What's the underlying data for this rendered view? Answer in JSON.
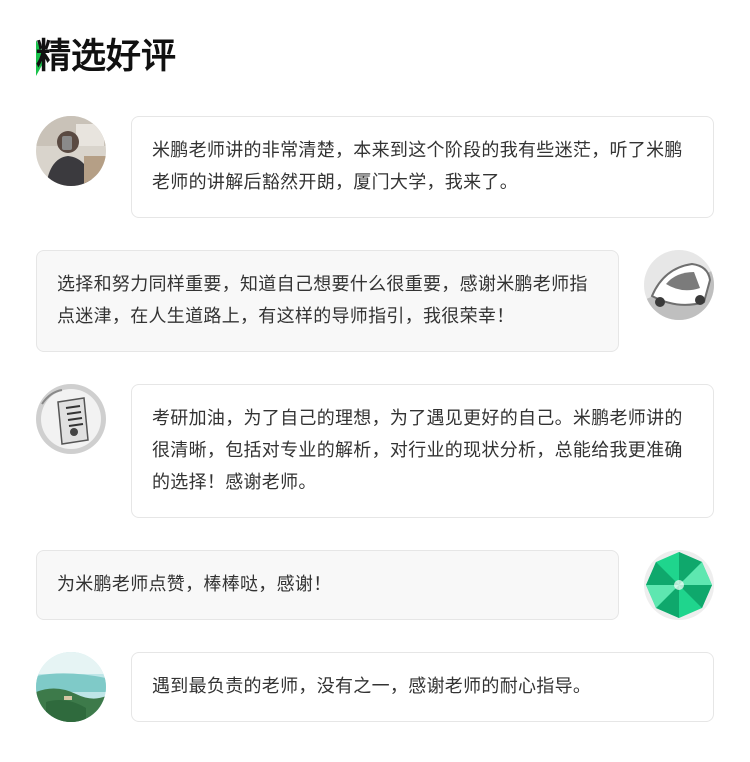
{
  "section": {
    "title": "精选好评"
  },
  "reviews": [
    {
      "text": "米鹏老师讲的非常清楚，本来到这个阶段的我有些迷茫，听了米鹏老师的讲解后豁然开朗，厦门大学，我来了。",
      "avatar_icon": "person-photo-avatar",
      "align": "left"
    },
    {
      "text": "选择和努力同样重要，知道自己想要什么很重要，感谢米鹏老师指点迷津，在人生道路上，有这样的导师指引，我很荣幸！",
      "avatar_icon": "car-photo-avatar",
      "align": "right"
    },
    {
      "text": "考研加油，为了自己的理想，为了遇见更好的自己。米鹏老师讲的很清晰，包括对专业的解析，对行业的现状分析，总能给我更准确的选择！感谢老师。",
      "avatar_icon": "sketch-photo-avatar",
      "align": "left"
    },
    {
      "text": "为米鹏老师点赞，棒棒哒，感谢！",
      "avatar_icon": "green-geometric-avatar",
      "align": "right"
    },
    {
      "text": "遇到最负责的老师，没有之一，感谢老师的耐心指导。",
      "avatar_icon": "landscape-photo-avatar",
      "align": "left"
    }
  ],
  "colors": {
    "accent": "#19c24b",
    "bubble_border": "#e6e6e6",
    "bubble_grey": "#f8f8f8",
    "text": "#333333"
  }
}
